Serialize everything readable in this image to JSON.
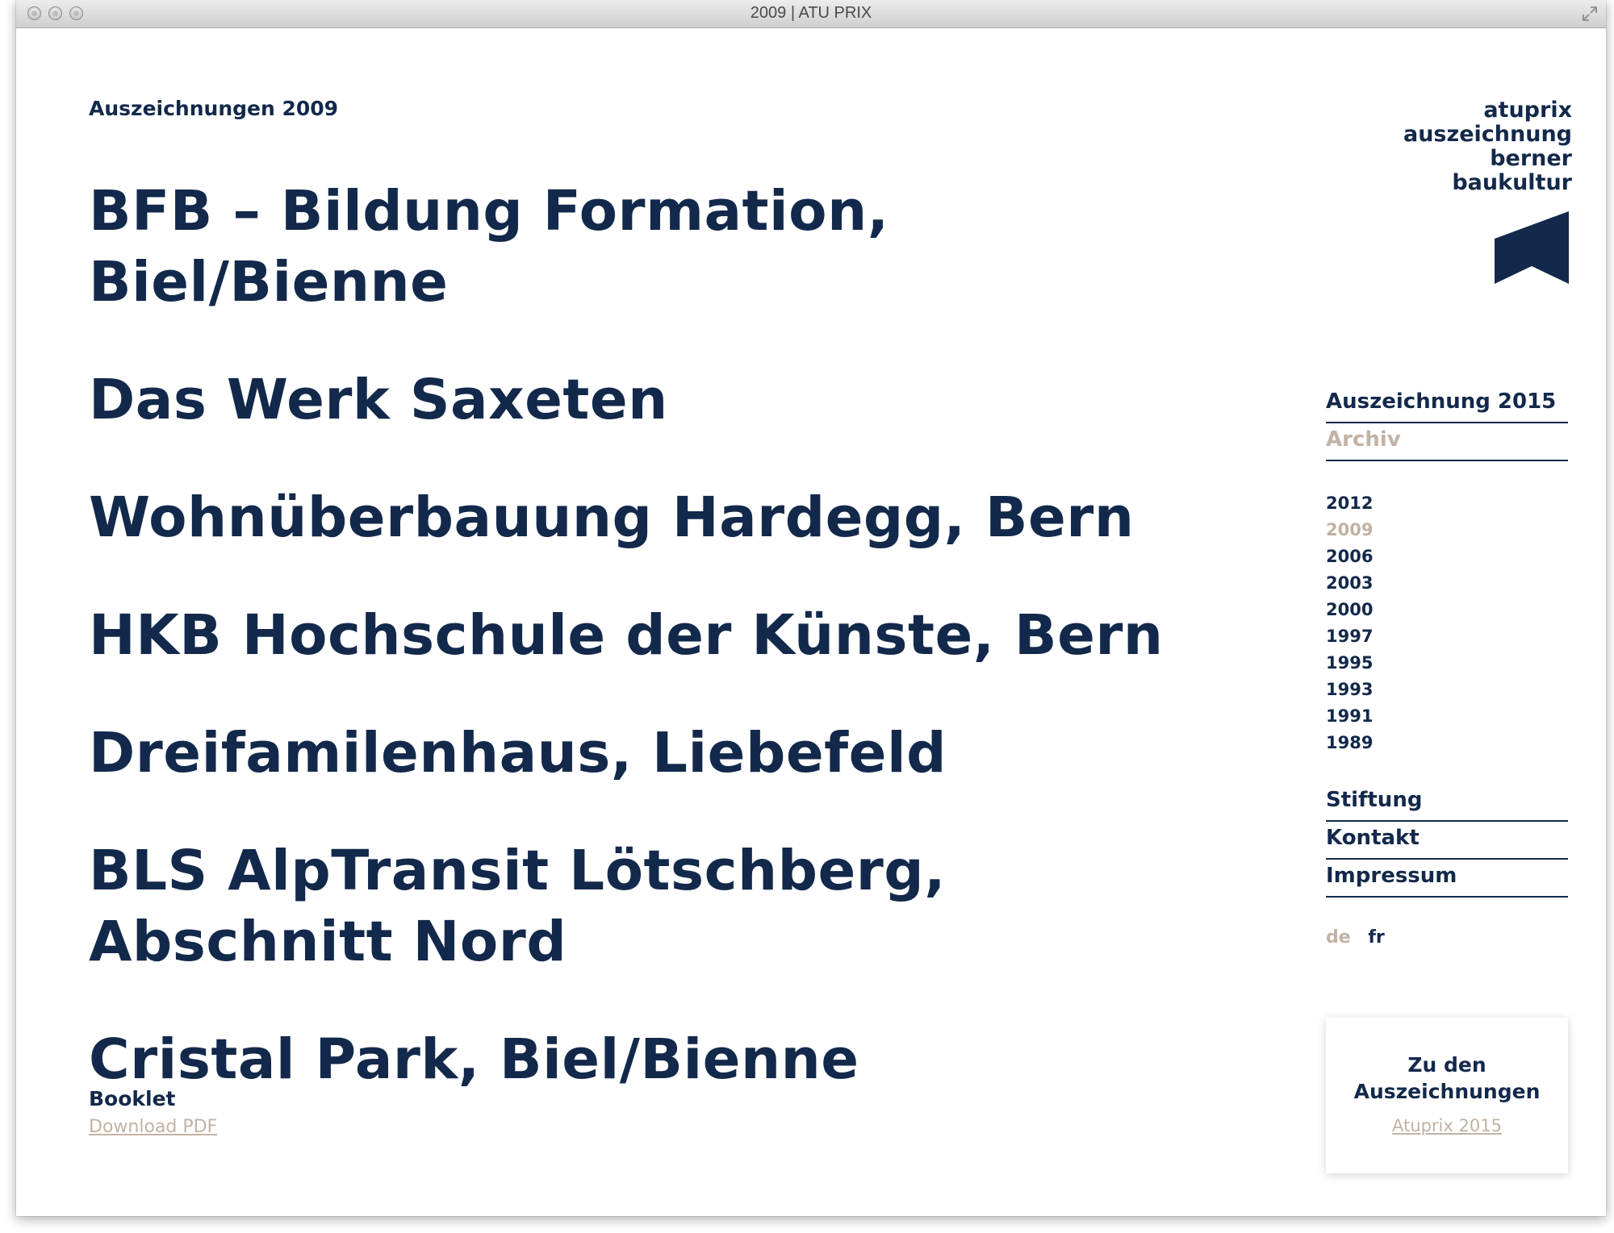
{
  "window": {
    "title": "2009 | ATU PRIX"
  },
  "page": {
    "kicker": "Auszeichnungen 2009",
    "projects": [
      "BFB – Bildung Formation, Biel/Bienne",
      "Das Werk Saxeten",
      "Wohnüberbauung Hardegg, Bern",
      "HKB Hochschule der Künste, Bern",
      "Dreifamilenhaus, Liebefeld",
      "BLS AlpTransit Lötschberg, Abschnitt Nord",
      "Cristal Park, Biel/Bienne"
    ],
    "booklet": {
      "heading": "Booklet",
      "link": "Download PDF"
    }
  },
  "logo": {
    "lines": [
      "atuprix",
      "auszeichnung",
      "berner",
      "baukultur"
    ]
  },
  "nav": {
    "primary": [
      "Auszeichnung 2015",
      "Archiv"
    ],
    "years": [
      "2012",
      "2009",
      "2006",
      "2003",
      "2000",
      "1997",
      "1995",
      "1993",
      "1991",
      "1989"
    ],
    "secondary": [
      "Stiftung",
      "Kontakt",
      "Impressum"
    ],
    "languages": [
      "de",
      "fr"
    ]
  },
  "promo": {
    "title_line1": "Zu den",
    "title_line2": "Auszeichnungen",
    "link": "Atuprix 2015"
  },
  "colors": {
    "navy": "#13294b",
    "muted": "#c2b2a4"
  }
}
